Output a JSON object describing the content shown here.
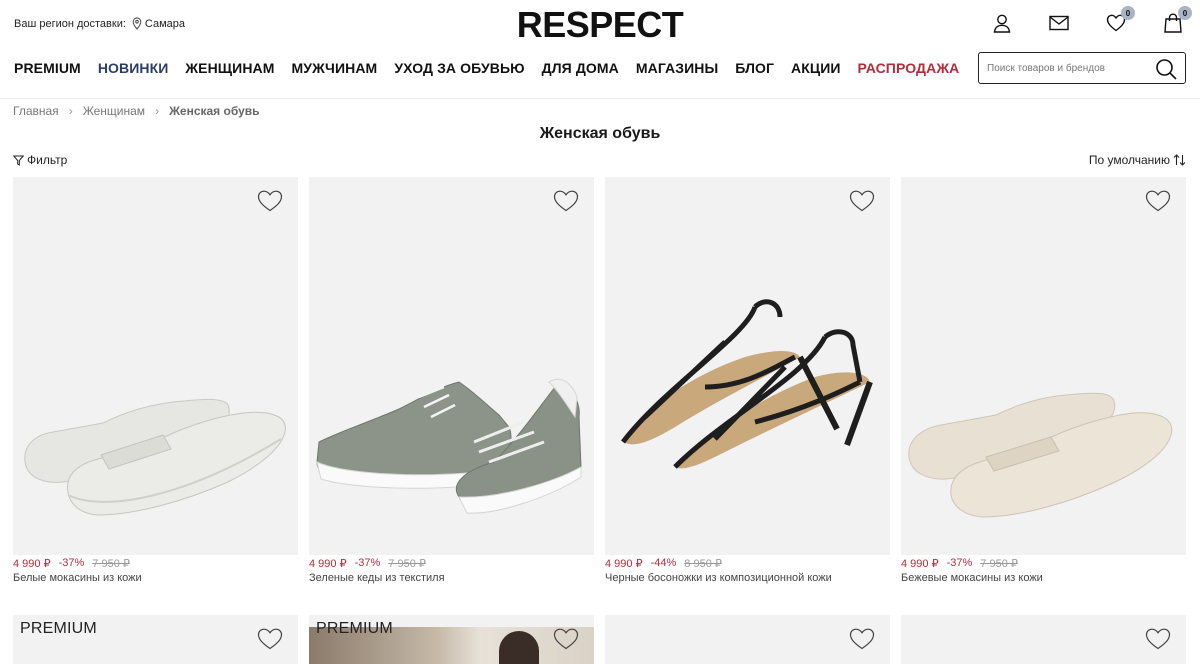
{
  "header": {
    "region_label": "Ваш регион доставки:",
    "city": "Самара",
    "logo": "RESPECT",
    "favorites_count": "0",
    "cart_count": "0"
  },
  "nav": {
    "items": [
      "PREMIUM",
      "НОВИНКИ",
      "ЖЕНЩИНАМ",
      "МУЖЧИНАМ",
      "УХОД ЗА ОБУВЬЮ",
      "ДЛЯ ДОМА",
      "МАГАЗИНЫ",
      "БЛОГ",
      "АКЦИИ",
      "РАСПРОДАЖА"
    ],
    "highlight_blue": "НОВИНКИ",
    "highlight_red": "РАСПРОДАЖА"
  },
  "search": {
    "placeholder": "Поиск товаров и брендов"
  },
  "breadcrumb": [
    "Главная",
    "Женщинам",
    "Женская обувь"
  ],
  "page_title": "Женская обувь",
  "filter_label": "Фильтр",
  "sort_label": "По умолчанию",
  "products": [
    {
      "price": "4 990 ₽",
      "discount": "-37%",
      "old_price": "7 950 ₽",
      "name": "Белые мокасины из кожи"
    },
    {
      "price": "4 990 ₽",
      "discount": "-37%",
      "old_price": "7 950 ₽",
      "name": "Зеленые кеды из текстиля"
    },
    {
      "price": "4 990 ₽",
      "discount": "-44%",
      "old_price": "8 950 ₽",
      "name": "Черные босоножки из композиционной кожи"
    },
    {
      "price": "4 990 ₽",
      "discount": "-37%",
      "old_price": "7 950 ₽",
      "name": "Бежевые мокасины из кожи"
    }
  ],
  "row2_tags": [
    "PREMIUM",
    "PREMIUM"
  ],
  "colors": {
    "accent_red": "#b22d3a",
    "accent_blue": "#2c3e66",
    "card_bg": "#f2f2f2",
    "badge": "#a9b4c4"
  }
}
